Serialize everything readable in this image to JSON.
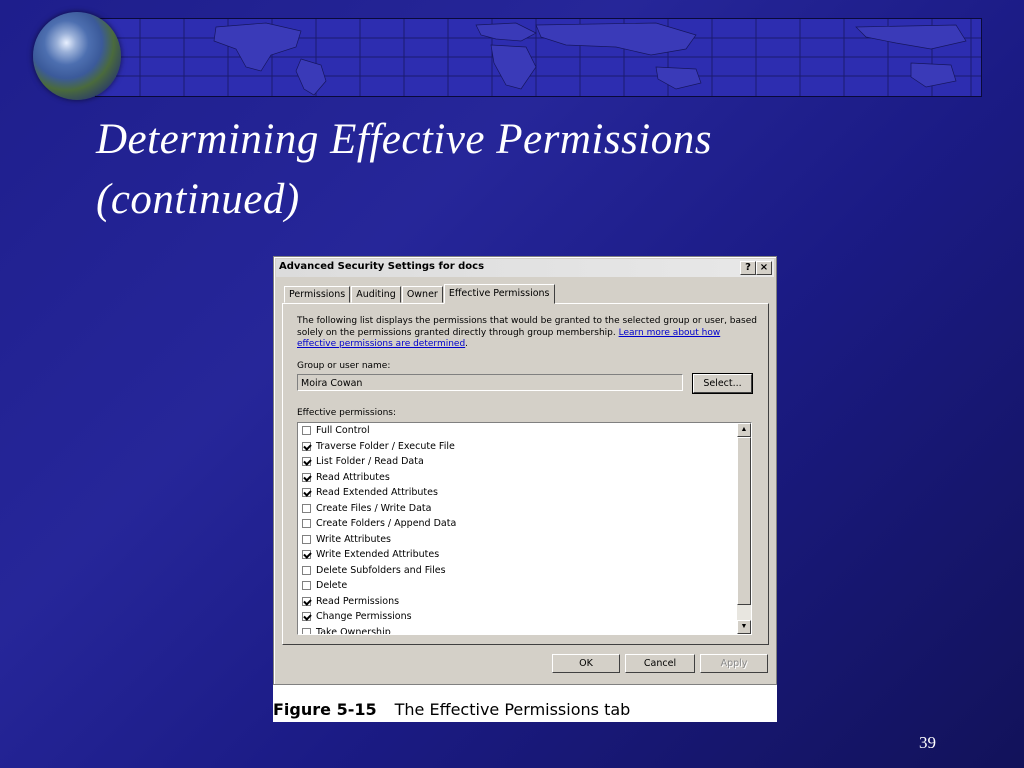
{
  "slide": {
    "title_line1": "Determining Effective Permissions",
    "title_line2": "(continued)",
    "page_number": "39"
  },
  "dialog": {
    "title": "Advanced Security Settings for docs",
    "help_button": "?",
    "close_button": "×",
    "tabs": [
      "Permissions",
      "Auditing",
      "Owner",
      "Effective Permissions"
    ],
    "active_tab": "Effective Permissions",
    "description": "The following list displays the permissions that would be granted to the selected group or user, based solely on the permissions granted directly through group membership.",
    "learn_more_link": "Learn more about how effective permissions are determined",
    "group_label": "Group or user name:",
    "group_value": "Moira Cowan",
    "select_button": "Select...",
    "effective_label": "Effective permissions:",
    "permissions": [
      {
        "label": "Full Control",
        "checked": false
      },
      {
        "label": "Traverse Folder / Execute File",
        "checked": true
      },
      {
        "label": "List Folder / Read Data",
        "checked": true
      },
      {
        "label": "Read Attributes",
        "checked": true
      },
      {
        "label": "Read Extended Attributes",
        "checked": true
      },
      {
        "label": "Create Files / Write Data",
        "checked": false
      },
      {
        "label": "Create Folders / Append Data",
        "checked": false
      },
      {
        "label": "Write Attributes",
        "checked": false
      },
      {
        "label": "Write Extended Attributes",
        "checked": true
      },
      {
        "label": "Delete Subfolders and Files",
        "checked": false
      },
      {
        "label": "Delete",
        "checked": false
      },
      {
        "label": "Read Permissions",
        "checked": true
      },
      {
        "label": "Change Permissions",
        "checked": true
      },
      {
        "label": "Take Ownership",
        "checked": false
      }
    ],
    "ok_button": "OK",
    "cancel_button": "Cancel",
    "apply_button": "Apply"
  },
  "caption": {
    "figure_number": "Figure 5-15",
    "text": "The Effective Permissions tab"
  },
  "colors": {
    "slide_background": "#22229a",
    "banner": "#2d2db0",
    "dialog_face": "#d4d0c8",
    "link": "#0000cc"
  }
}
